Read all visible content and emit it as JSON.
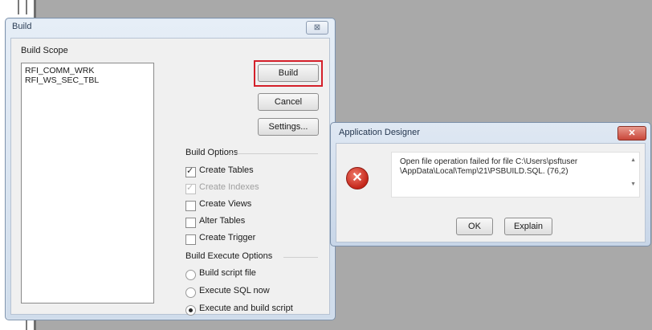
{
  "build_dialog": {
    "title": "Build",
    "close_glyph": "⊠",
    "scope_label": "Build Scope",
    "scope_items": [
      "RFI_COMM_WRK",
      "RFI_WS_SEC_TBL"
    ],
    "buttons": {
      "build": "Build",
      "cancel": "Cancel",
      "settings": "Settings..."
    },
    "build_options_label": "Build Options",
    "options": [
      {
        "label": "Create Tables",
        "checked": true,
        "enabled": true
      },
      {
        "label": "Create Indexes",
        "checked": true,
        "enabled": false
      },
      {
        "label": "Create Views",
        "checked": false,
        "enabled": true
      },
      {
        "label": "Alter Tables",
        "checked": false,
        "enabled": true
      },
      {
        "label": "Create Trigger",
        "checked": false,
        "enabled": true
      }
    ],
    "execute_options_label": "Build Execute Options",
    "execute_options": [
      {
        "label": "Build script file",
        "selected": false
      },
      {
        "label": "Execute SQL now",
        "selected": false
      },
      {
        "label": "Execute and build script",
        "selected": true
      }
    ],
    "highlight_color": "#d4202a"
  },
  "app_designer_dialog": {
    "title": "Application Designer",
    "close_glyph": "✕",
    "icon": "error-icon",
    "message_line1": "Open file operation failed for file C:\\Users\\psftuser",
    "message_line2": "\\AppData\\Local\\Temp\\21\\PSBUILD.SQL. (76,2)",
    "buttons": {
      "ok": "OK",
      "explain": "Explain"
    }
  }
}
